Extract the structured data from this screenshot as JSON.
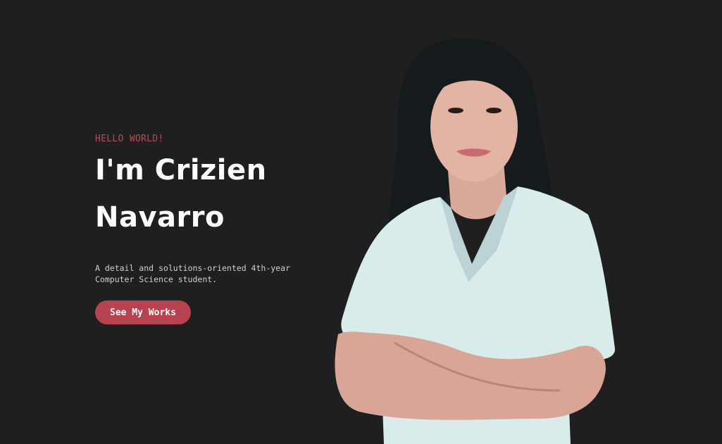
{
  "hero": {
    "greeting": "HELLO WORLD!",
    "name_line1": "I'm Crizien",
    "name_line2": "Navarro",
    "description": "A detail and solutions-oriented 4th-year Computer Science student.",
    "cta_label": "See My Works"
  },
  "colors": {
    "background": "#1f1f1f",
    "accent": "#b6434f",
    "greeting": "#c0485a",
    "heading": "#ffffff"
  }
}
